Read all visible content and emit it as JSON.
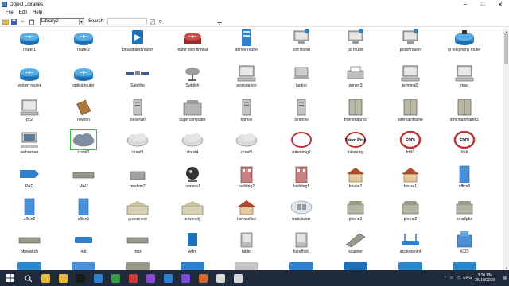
{
  "window": {
    "title": "Object Libraries",
    "controls": [
      "–",
      "□",
      "✕"
    ]
  },
  "menu": [
    "File",
    "Edit",
    "Help"
  ],
  "toolbar": {
    "library_value": "Library2",
    "search_label": "Search:",
    "search_value": ""
  },
  "rows": [
    [
      {
        "label": "router1",
        "icon": "router-icon"
      },
      {
        "label": "router2",
        "icon": "router-icon"
      },
      {
        "label": "broadband router",
        "icon": "broadband-router-icon"
      },
      {
        "label": "router with firewall",
        "icon": "router-firewall-icon"
      },
      {
        "label": "server router",
        "icon": "server-router-icon"
      },
      {
        "label": "soft router",
        "icon": "soft-router-icon"
      },
      {
        "label": "pc router",
        "icon": "pc-router-icon"
      },
      {
        "label": "pcsoftrouter",
        "icon": "pc-soft-router-icon"
      },
      {
        "label": "ip telephony router",
        "icon": "ip-telephony-router-icon"
      }
    ],
    [
      {
        "label": "voicen router",
        "icon": "voice-router-icon"
      },
      {
        "label": "opticalrouter",
        "icon": "optical-router-icon"
      },
      {
        "label": "Satellite",
        "icon": "satellite-icon"
      },
      {
        "label": "Satdish",
        "icon": "satellite-dish-icon"
      },
      {
        "label": "workstation",
        "icon": "workstation-icon"
      },
      {
        "label": "laptop",
        "icon": "laptop-icon"
      },
      {
        "label": "printer3",
        "icon": "printer-icon"
      },
      {
        "label": "terminal0",
        "icon": "terminal-icon"
      },
      {
        "label": "mac",
        "icon": "mac-icon"
      }
    ],
    [
      {
        "label": "pc2",
        "icon": "pc-icon"
      },
      {
        "label": "newton",
        "icon": "newton-icon"
      },
      {
        "label": "fileserver",
        "icon": "fileserver-icon"
      },
      {
        "label": "supercomputer",
        "icon": "supercomputer-icon"
      },
      {
        "label": "hpmini",
        "icon": "hpmini-icon"
      },
      {
        "label": "ibmmini",
        "icon": "ibmmini-icon"
      },
      {
        "label": "frontendproc",
        "icon": "frontend-processor-icon"
      },
      {
        "label": "ibmmainframe",
        "icon": "ibm-mainframe-icon"
      },
      {
        "label": "ibm mainframe2",
        "icon": "ibm-mainframe-icon"
      }
    ],
    [
      {
        "label": "webserver",
        "icon": "webserver-icon"
      },
      {
        "label": "cloud2",
        "icon": "cloud-icon",
        "selected": true
      },
      {
        "label": "cloud3",
        "icon": "cloud-icon"
      },
      {
        "label": "cloud4",
        "icon": "cloud-icon"
      },
      {
        "label": "cloud5",
        "icon": "cloud-icon"
      },
      {
        "label": "tokenring2",
        "icon": "token-ring-icon"
      },
      {
        "label": "tokenring",
        "icon": "token-ring-icon",
        "text": "Token Ring"
      },
      {
        "label": "fddi1",
        "icon": "fddi-icon",
        "text": "FDDI"
      },
      {
        "label": "fddi",
        "icon": "fddi-icon",
        "text": "FDDI"
      }
    ],
    [
      {
        "label": "PAD",
        "icon": "pad-icon"
      },
      {
        "label": "MAU",
        "icon": "mau-icon"
      },
      {
        "label": "modem2",
        "icon": "modem-icon"
      },
      {
        "label": "camera1",
        "icon": "camera-icon"
      },
      {
        "label": "building2",
        "icon": "building-icon"
      },
      {
        "label": "building1",
        "icon": "building-icon"
      },
      {
        "label": "house2",
        "icon": "house-icon"
      },
      {
        "label": "house1",
        "icon": "house-icon"
      },
      {
        "label": "office3",
        "icon": "office-icon"
      }
    ],
    [
      {
        "label": "office2",
        "icon": "office-icon"
      },
      {
        "label": "office1",
        "icon": "office-icon"
      },
      {
        "label": "goverment",
        "icon": "government-icon"
      },
      {
        "label": "university",
        "icon": "university-icon"
      },
      {
        "label": "homeoffice",
        "icon": "home-office-icon"
      },
      {
        "label": "webcluster",
        "icon": "webcluster-icon"
      },
      {
        "label": "phone3",
        "icon": "phone-icon"
      },
      {
        "label": "phone2",
        "icon": "phone-icon"
      },
      {
        "label": "smallpbx",
        "icon": "small-pbx-icon"
      }
    ],
    [
      {
        "label": "pbxswitch",
        "icon": "pbx-switch-icon"
      },
      {
        "label": "nat",
        "icon": "nat-icon"
      },
      {
        "label": "mux",
        "icon": "mux-icon"
      },
      {
        "label": "wdm",
        "icon": "wdm-icon"
      },
      {
        "label": "tablet",
        "icon": "tablet-icon"
      },
      {
        "label": "handheld",
        "icon": "handheld-icon"
      },
      {
        "label": "scanner",
        "icon": "scanner-icon"
      },
      {
        "label": "accesspoint",
        "icon": "access-point-icon"
      },
      {
        "label": "h323",
        "icon": "h323-icon"
      }
    ]
  ],
  "taskbar": {
    "apps": [
      "start-icon",
      "search-icon",
      "chrome-icon",
      "chrome-icon",
      "terminal-icon",
      "app-icon",
      "app-icon",
      "app-icon",
      "app-icon",
      "app-icon",
      "viber-icon",
      "app-icon",
      "app-icon",
      "app-icon"
    ],
    "language": "ENG",
    "time": "3:30 PM",
    "date": "25/10/2020"
  }
}
